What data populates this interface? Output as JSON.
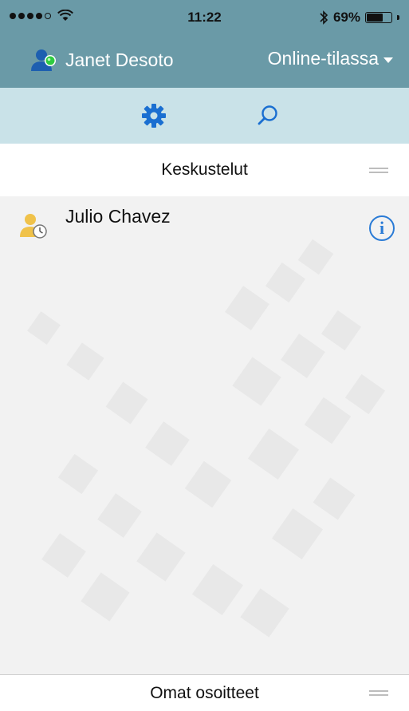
{
  "status_bar": {
    "signal_dots_filled": 4,
    "signal_dots_total": 5,
    "time": "11:22",
    "bluetooth_icon": "bluetooth-icon",
    "battery_percent": "69%",
    "battery_level": 0.69
  },
  "header": {
    "user_name": "Janet Desoto",
    "presence_status": "Online-tilassa",
    "user_icon": "user-online-icon",
    "presence_color": "#2ecc40"
  },
  "toolbar": {
    "settings_icon": "gear-icon",
    "search_icon": "search-icon",
    "accent": "#1a6fd1"
  },
  "sections": {
    "conversations_title": "Keskustelut",
    "contacts_title": "Omat osoitteet"
  },
  "conversations": [
    {
      "name": "Julio Chavez",
      "icon": "user-away-clock-icon",
      "action_icon": "info-icon",
      "action_label": "i"
    }
  ],
  "colors": {
    "header_bg": "#6a9aa7",
    "toolbar_bg": "#c9e2e8",
    "content_bg": "#f2f2f2",
    "link_blue": "#2a7bd6"
  }
}
